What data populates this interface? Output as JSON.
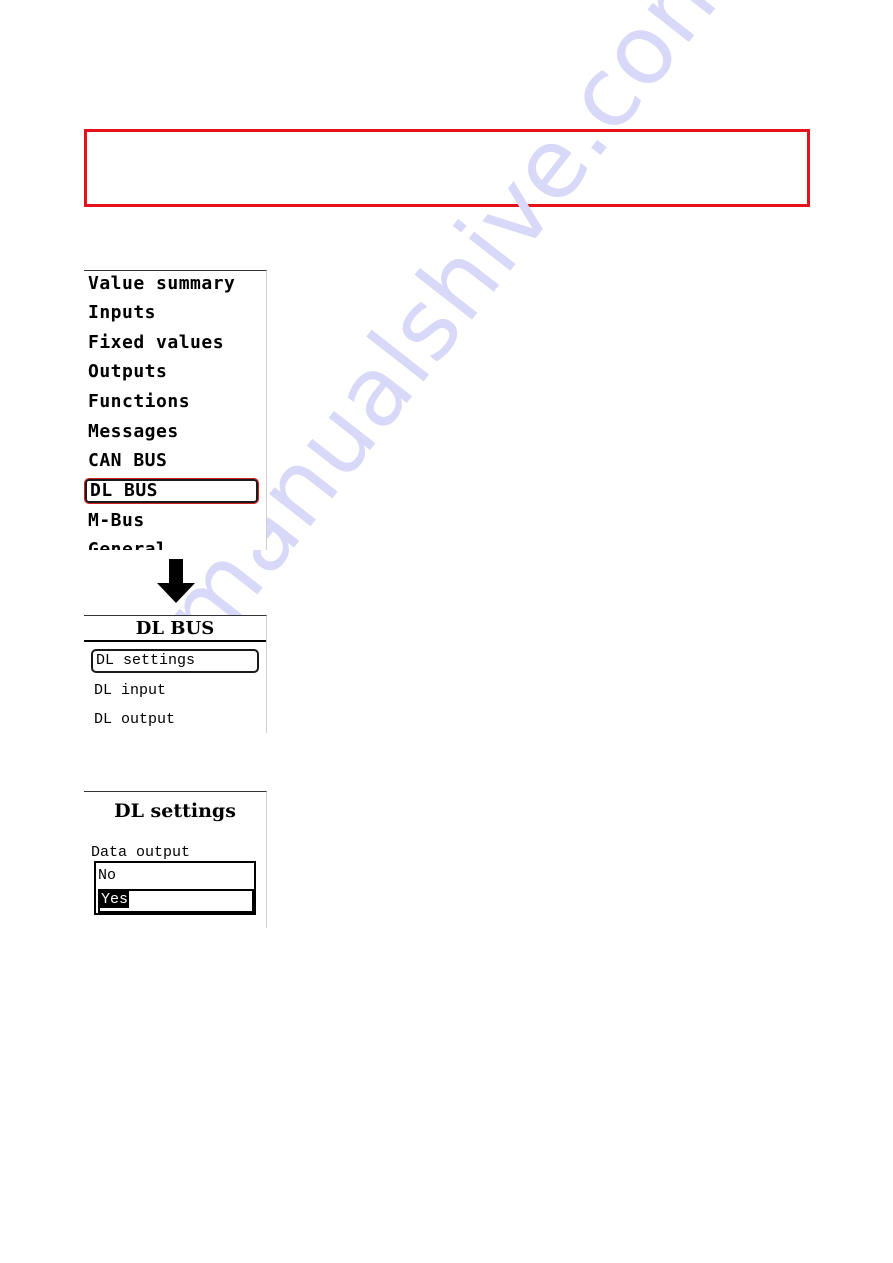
{
  "warning_box": {
    "text": "",
    "border_color": "#e3121b"
  },
  "watermark": {
    "text": "manualshive.com",
    "color": "#d8d8f8"
  },
  "main_menu": {
    "items": [
      {
        "label": "Value summary"
      },
      {
        "label": "Inputs"
      },
      {
        "label": "Fixed values"
      },
      {
        "label": "Outputs"
      },
      {
        "label": "Functions"
      },
      {
        "label": "Messages"
      },
      {
        "label": "CAN BUS"
      },
      {
        "label": "DL BUS",
        "selected": true
      },
      {
        "label": "M-Bus"
      },
      {
        "label": "General"
      }
    ],
    "selected_highlight_color": "#d42020"
  },
  "arrow": {
    "icon": "arrow-down-icon"
  },
  "dl_bus_menu": {
    "title": "DL BUS",
    "items": [
      {
        "label": "DL settings",
        "selected": true
      },
      {
        "label": "DL input"
      },
      {
        "label": "DL output"
      }
    ]
  },
  "dl_settings": {
    "title": "DL settings",
    "field_label": "Data output",
    "options": [
      {
        "label": "No"
      },
      {
        "label": "Yes",
        "selected": true
      }
    ],
    "selected_value": "Yes"
  }
}
